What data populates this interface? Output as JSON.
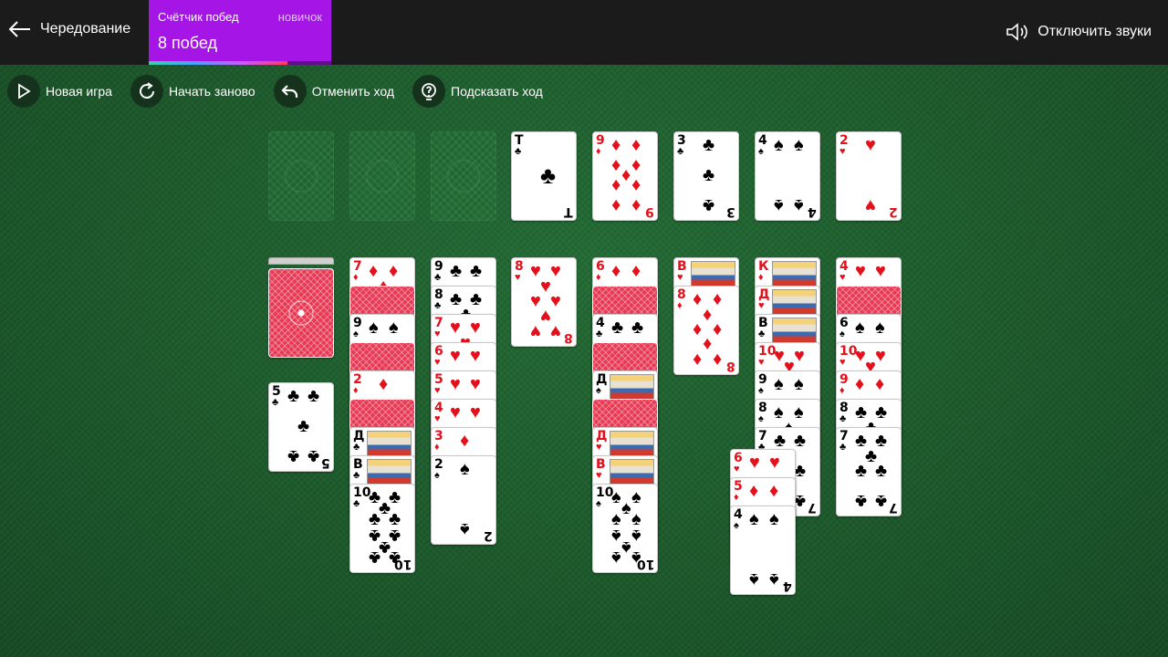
{
  "header": {
    "title": "Чередование",
    "wins_label": "Счётчик побед",
    "wins_level": "новичок",
    "wins_count": "8 побед",
    "wins_progress": 0.76,
    "sound_label": "Отключить звуки"
  },
  "toolbar": {
    "new_game": "Новая игра",
    "restart": "Начать заново",
    "undo": "Отменить ход",
    "hint": "Подсказать ход"
  },
  "colors": {
    "red": "#e4101c",
    "felt": "#1c5a2c",
    "wins_bg": "#a516e6"
  },
  "foundations": [
    {
      "rank": "Т",
      "suit": "♣"
    },
    {
      "rank": "9",
      "suit": "♦"
    },
    {
      "rank": "3",
      "suit": "♣"
    },
    {
      "rank": "4",
      "suit": "♠"
    },
    {
      "rank": "2",
      "suit": "♥"
    }
  ],
  "waste_card": {
    "rank": "5",
    "suit": "♣"
  },
  "columns": [
    [
      {
        "rank": "7",
        "suit": "♦"
      },
      {
        "down": true
      },
      {
        "rank": "9",
        "suit": "♠"
      },
      {
        "down": true
      },
      {
        "rank": "2",
        "suit": "♦"
      },
      {
        "down": true
      },
      {
        "rank": "Д",
        "suit": "♣"
      },
      {
        "rank": "В",
        "suit": "♣"
      },
      {
        "rank": "10",
        "suit": "♣"
      }
    ],
    [
      {
        "rank": "9",
        "suit": "♣"
      },
      {
        "rank": "8",
        "suit": "♣"
      },
      {
        "rank": "7",
        "suit": "♥"
      },
      {
        "rank": "6",
        "suit": "♥"
      },
      {
        "rank": "5",
        "suit": "♥"
      },
      {
        "rank": "4",
        "suit": "♥"
      },
      {
        "rank": "3",
        "suit": "♦"
      },
      {
        "rank": "2",
        "suit": "♠"
      }
    ],
    [
      {
        "rank": "8",
        "suit": "♥"
      }
    ],
    [
      {
        "rank": "6",
        "suit": "♦"
      },
      {
        "down": true
      },
      {
        "rank": "4",
        "suit": "♣"
      },
      {
        "down": true
      },
      {
        "rank": "Д",
        "suit": "♠"
      },
      {
        "down": true
      },
      {
        "rank": "Д",
        "suit": "♥"
      },
      {
        "rank": "В",
        "suit": "♥"
      },
      {
        "rank": "10",
        "suit": "♠"
      }
    ],
    [
      {
        "rank": "В",
        "suit": "♥"
      },
      {
        "rank": "8",
        "suit": "♦"
      }
    ],
    [
      {
        "rank": "К",
        "suit": "♦"
      },
      {
        "rank": "Д",
        "suit": "♥"
      },
      {
        "rank": "В",
        "suit": "♣"
      },
      {
        "rank": "10",
        "suit": "♥"
      },
      {
        "rank": "9",
        "suit": "♠"
      },
      {
        "rank": "8",
        "suit": "♠"
      },
      {
        "rank": "7",
        "suit": "♣"
      }
    ],
    [
      {
        "rank": "4",
        "suit": "♥"
      },
      {
        "down": true
      },
      {
        "rank": "6",
        "suit": "♠"
      },
      {
        "rank": "10",
        "suit": "♥"
      },
      {
        "rank": "9",
        "suit": "♦"
      },
      {
        "rank": "8",
        "suit": "♣"
      },
      {
        "rank": "7",
        "suit": "♣"
      }
    ]
  ],
  "dragged": [
    {
      "rank": "6",
      "suit": "♥"
    },
    {
      "rank": "5",
      "suit": "♦"
    },
    {
      "rank": "4",
      "suit": "♠"
    }
  ]
}
